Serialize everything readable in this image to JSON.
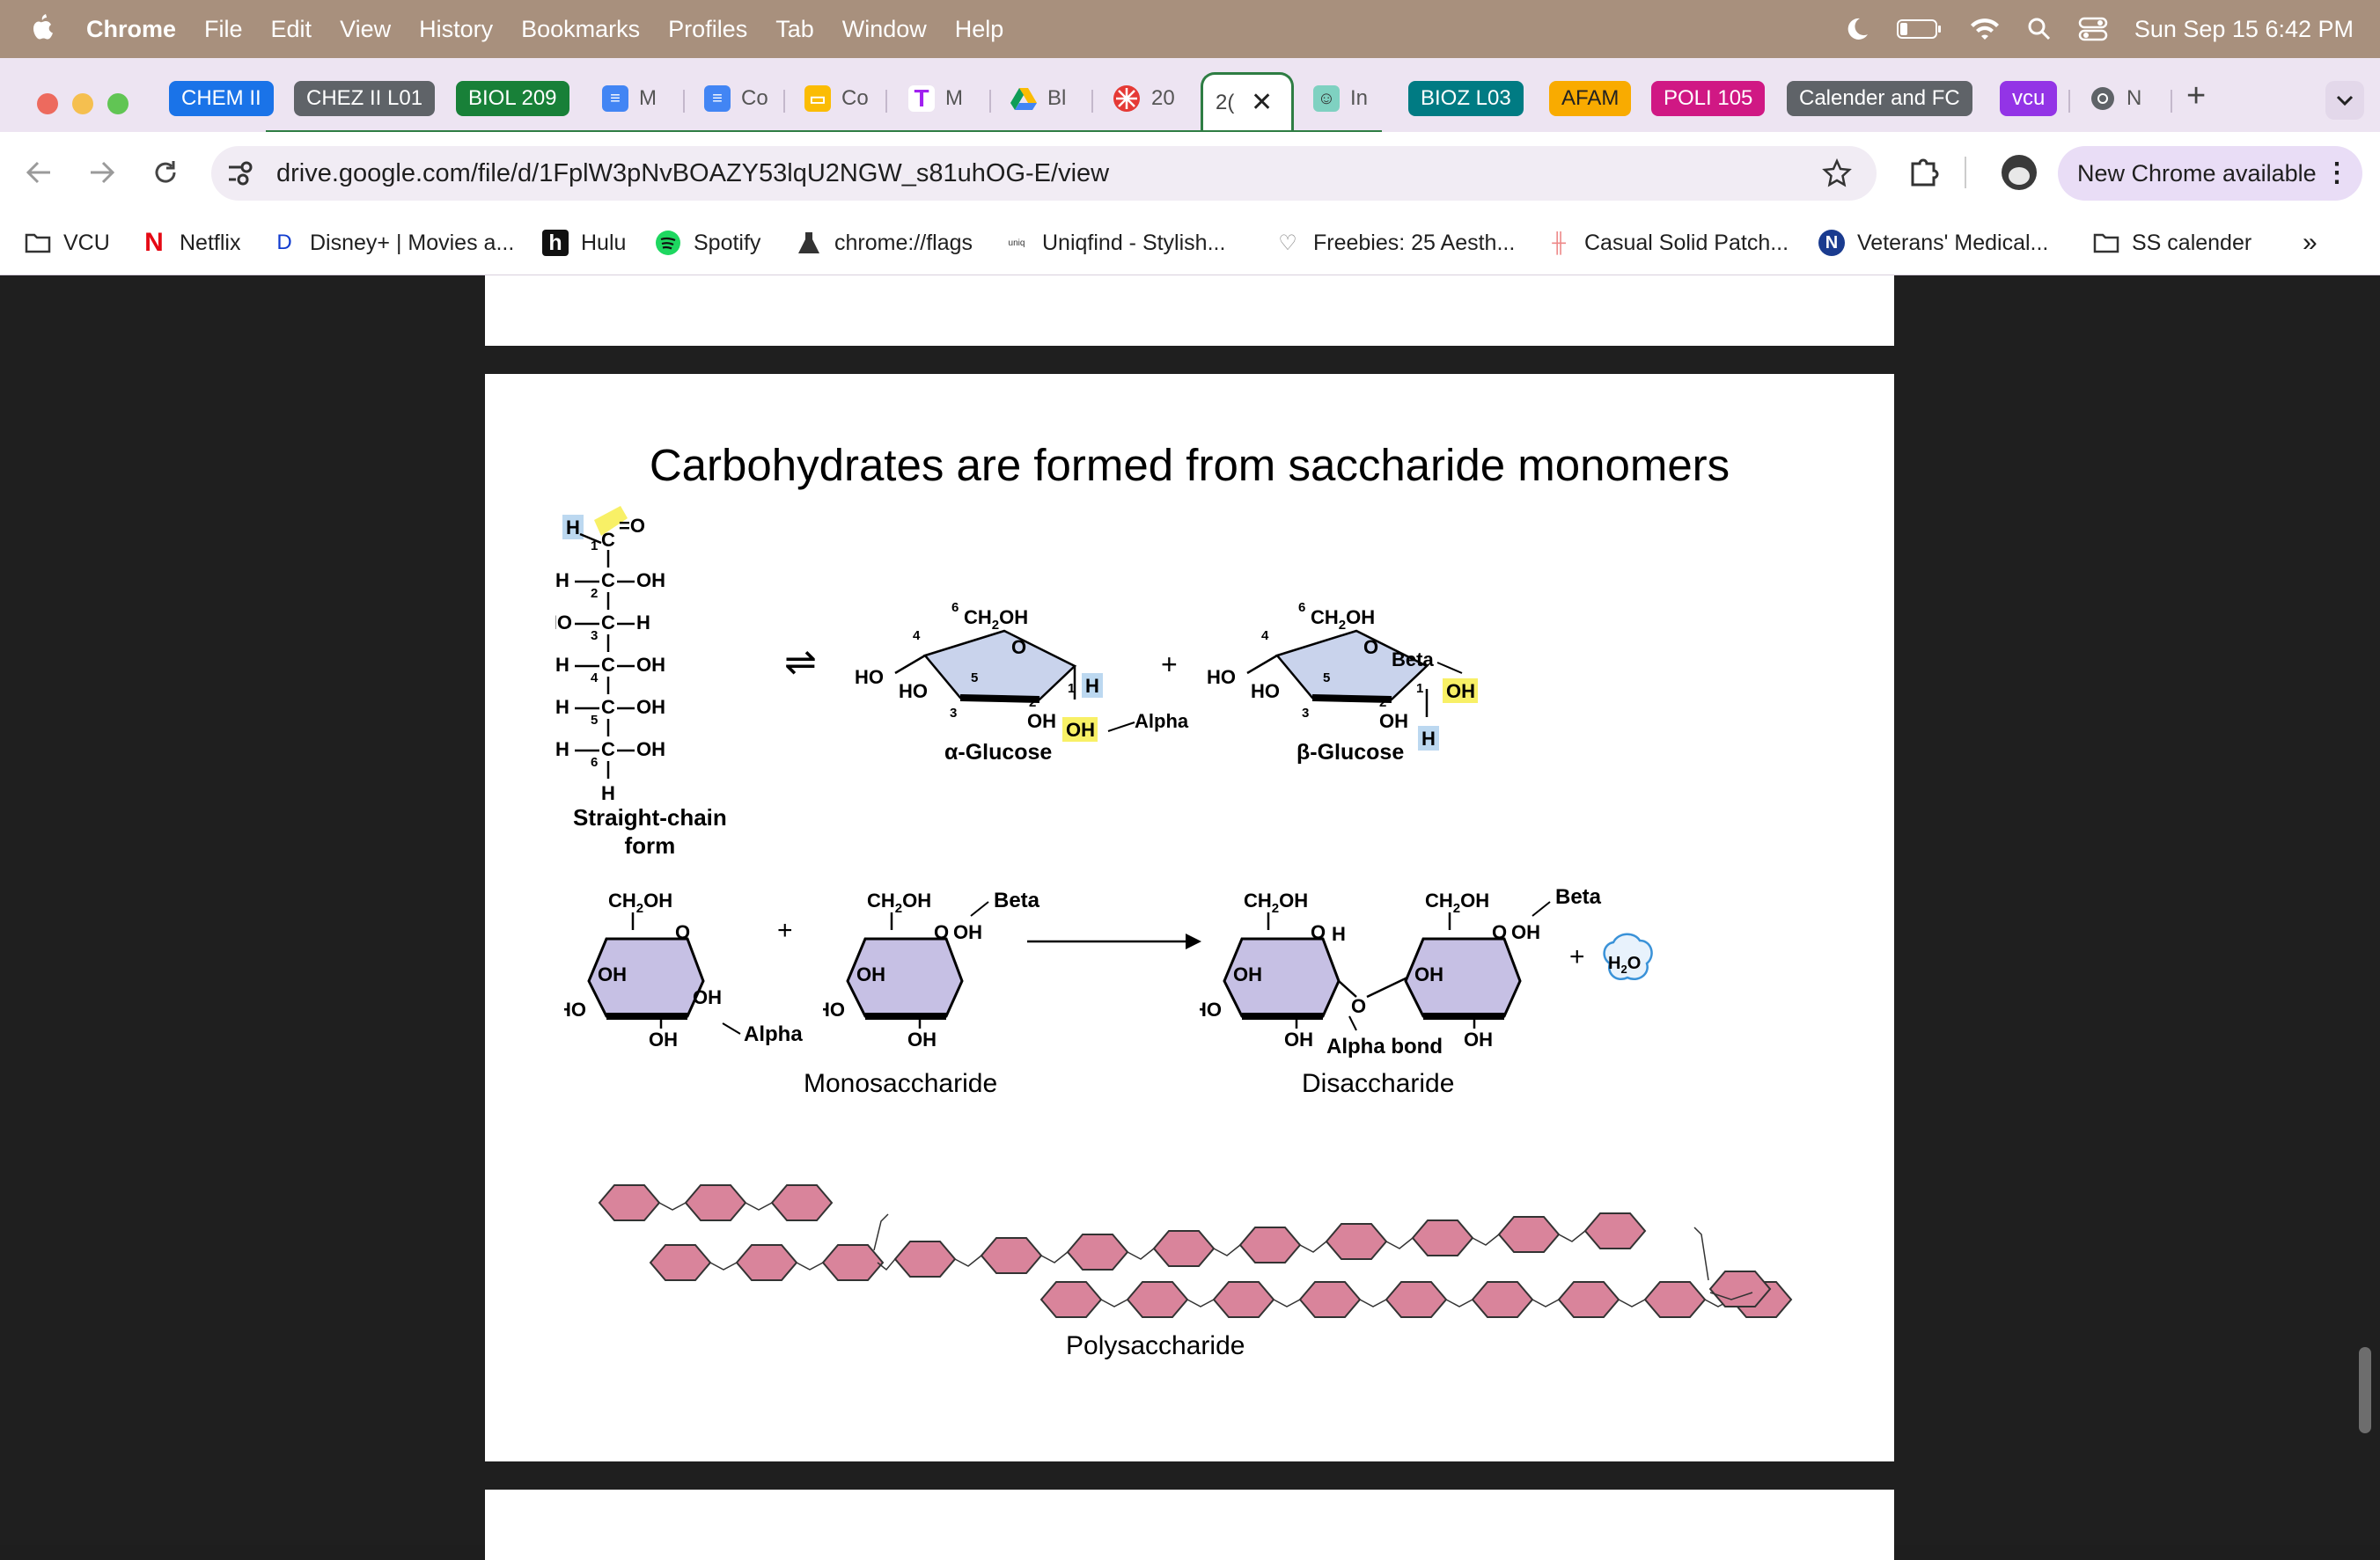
{
  "menubar": {
    "app": "Chrome",
    "items": [
      "File",
      "Edit",
      "View",
      "History",
      "Bookmarks",
      "Profiles",
      "Tab",
      "Window",
      "Help"
    ],
    "datetime": "Sun Sep 15  6:42 PM"
  },
  "tabs": [
    {
      "label": "CHEM II",
      "color": "#1a73e8"
    },
    {
      "label": "CHEZ II L01",
      "color": "#5f6368"
    },
    {
      "label": "BIOL 209",
      "color": "#188038"
    },
    {
      "label": "M",
      "fav": "docs"
    },
    {
      "label": "Co",
      "fav": "docs"
    },
    {
      "label": "Co",
      "fav": "slides"
    },
    {
      "label": "M",
      "fav": "t"
    },
    {
      "label": "Bl",
      "fav": "drive"
    },
    {
      "label": "20",
      "fav": "red"
    },
    {
      "label": "2(",
      "active": true
    },
    {
      "label": "In",
      "fav": "face"
    },
    {
      "label": "BIOZ L03",
      "color": "#007b83"
    },
    {
      "label": "AFAM",
      "color": "#f9ab00"
    },
    {
      "label": "POLI 105",
      "color": "#d01884"
    },
    {
      "label": "Calender and FC",
      "color": "#5f6368"
    },
    {
      "label": "vcu",
      "color": "#9334e6"
    },
    {
      "label": "N",
      "fav": "chrome"
    }
  ],
  "omnibox": {
    "url": "drive.google.com/file/d/1FplW3pNvBOAZY53lqU2NGW_s81uhOG-E/view"
  },
  "new_chrome": "New Chrome available",
  "bookmarks": [
    {
      "label": "VCU",
      "icon": "folder-icon"
    },
    {
      "label": "Netflix",
      "icon": "netflix-icon"
    },
    {
      "label": "Disney+ | Movies a...",
      "icon": "disney-icon"
    },
    {
      "label": "Hulu",
      "icon": "hulu-icon"
    },
    {
      "label": "Spotify",
      "icon": "spotify-icon"
    },
    {
      "label": "chrome://flags",
      "icon": "flask-icon"
    },
    {
      "label": "Uniqfind - Stylish...",
      "icon": "uniqfind-icon"
    },
    {
      "label": "Freebies: 25 Aesth...",
      "icon": "heart-icon"
    },
    {
      "label": "Casual Solid Patch...",
      "icon": "patch-icon"
    },
    {
      "label": "Veterans' Medical...",
      "icon": "n-icon"
    },
    {
      "label": "SS calender",
      "icon": "folder-icon"
    }
  ],
  "slide": {
    "title": "Carbohydrates are formed from saccharide monomers",
    "straight_chain_label": "Straight-chain\nform",
    "alpha_glucose": "α-Glucose",
    "beta_glucose": "β-Glucose",
    "alpha": "Alpha",
    "beta": "Beta",
    "alpha_bond": "Alpha bond",
    "monosaccharide": "Monosaccharide",
    "disaccharide": "Disaccharide",
    "polysaccharide": "Polysaccharide"
  }
}
